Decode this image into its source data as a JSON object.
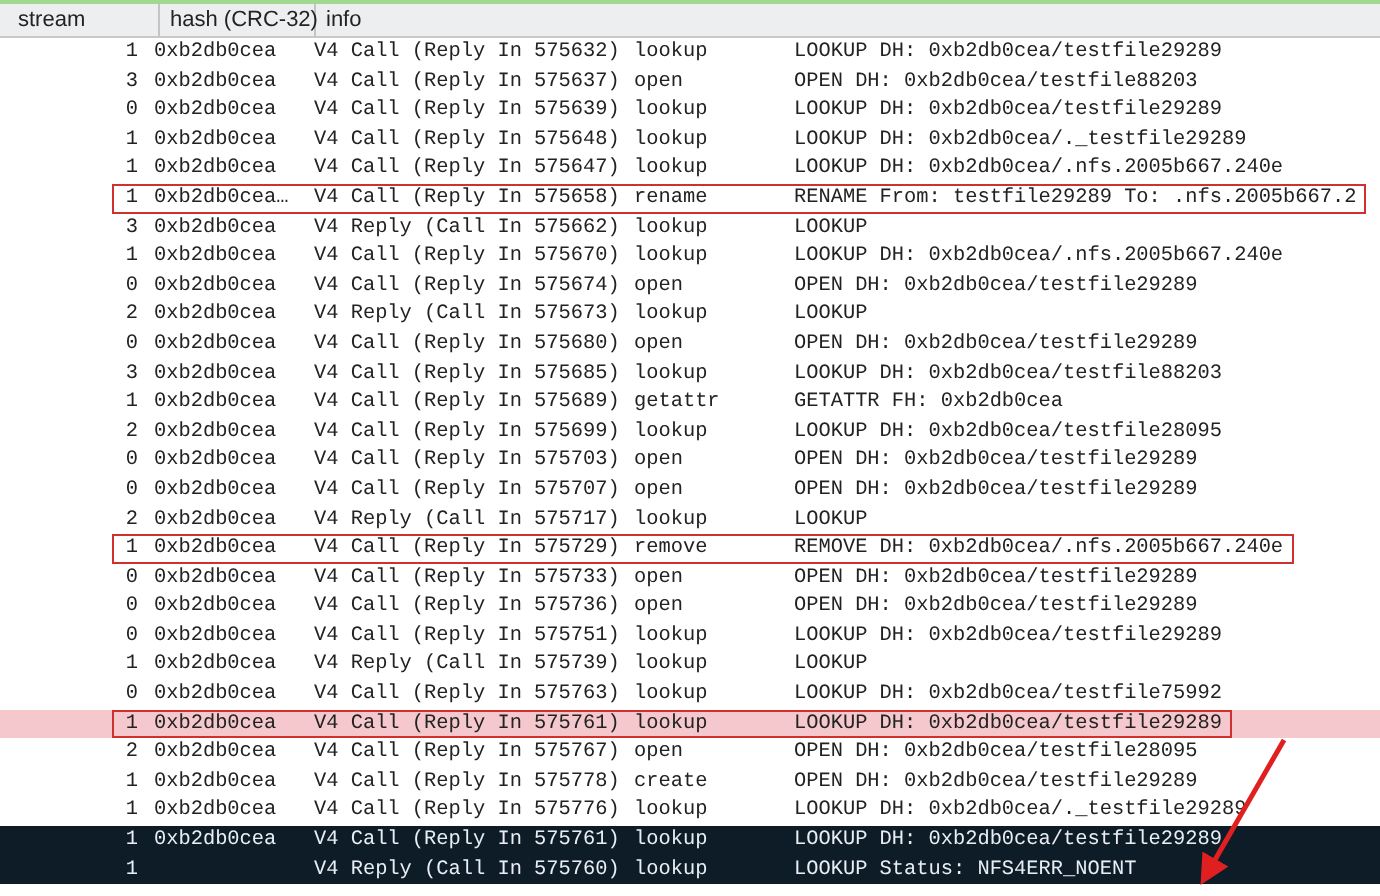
{
  "table": {
    "columns": [
      "stream",
      "hash (CRC-32)",
      "info"
    ],
    "rows": [
      {
        "stream": "1",
        "hash": "0xb2db0cea",
        "call": "V4 Call (Reply In 575632)",
        "op": "lookup",
        "summary": "LOOKUP DH: 0xb2db0cea/testfile29289",
        "boxed": false,
        "marked": false,
        "selected": false
      },
      {
        "stream": "3",
        "hash": "0xb2db0cea",
        "call": "V4 Call (Reply In 575637)",
        "op": "open",
        "summary": "OPEN DH: 0xb2db0cea/testfile88203",
        "boxed": false,
        "marked": false,
        "selected": false
      },
      {
        "stream": "0",
        "hash": "0xb2db0cea",
        "call": "V4 Call (Reply In 575639)",
        "op": "lookup",
        "summary": "LOOKUP DH: 0xb2db0cea/testfile29289",
        "boxed": false,
        "marked": false,
        "selected": false
      },
      {
        "stream": "1",
        "hash": "0xb2db0cea",
        "call": "V4 Call (Reply In 575648)",
        "op": "lookup",
        "summary": "LOOKUP DH: 0xb2db0cea/._testfile29289",
        "boxed": false,
        "marked": false,
        "selected": false
      },
      {
        "stream": "1",
        "hash": "0xb2db0cea",
        "call": "V4 Call (Reply In 575647)",
        "op": "lookup",
        "summary": "LOOKUP DH: 0xb2db0cea/.nfs.2005b667.240e",
        "boxed": false,
        "marked": false,
        "selected": false
      },
      {
        "stream": "1",
        "hash": "0xb2db0cea…",
        "call": "V4 Call (Reply In 575658)",
        "op": "rename",
        "summary": "RENAME From: testfile29289 To: .nfs.2005b667.2",
        "boxed": true,
        "marked": false,
        "selected": false
      },
      {
        "stream": "3",
        "hash": "0xb2db0cea",
        "call": "V4 Reply (Call In 575662)",
        "op": "lookup",
        "summary": "LOOKUP",
        "boxed": false,
        "marked": false,
        "selected": false
      },
      {
        "stream": "1",
        "hash": "0xb2db0cea",
        "call": "V4 Call (Reply In 575670)",
        "op": "lookup",
        "summary": "LOOKUP DH: 0xb2db0cea/.nfs.2005b667.240e",
        "boxed": false,
        "marked": false,
        "selected": false
      },
      {
        "stream": "0",
        "hash": "0xb2db0cea",
        "call": "V4 Call (Reply In 575674)",
        "op": "open",
        "summary": "OPEN DH: 0xb2db0cea/testfile29289",
        "boxed": false,
        "marked": false,
        "selected": false
      },
      {
        "stream": "2",
        "hash": "0xb2db0cea",
        "call": "V4 Reply (Call In 575673)",
        "op": "lookup",
        "summary": "LOOKUP",
        "boxed": false,
        "marked": false,
        "selected": false
      },
      {
        "stream": "0",
        "hash": "0xb2db0cea",
        "call": "V4 Call (Reply In 575680)",
        "op": "open",
        "summary": "OPEN DH: 0xb2db0cea/testfile29289",
        "boxed": false,
        "marked": false,
        "selected": false
      },
      {
        "stream": "3",
        "hash": "0xb2db0cea",
        "call": "V4 Call (Reply In 575685)",
        "op": "lookup",
        "summary": "LOOKUP DH: 0xb2db0cea/testfile88203",
        "boxed": false,
        "marked": false,
        "selected": false
      },
      {
        "stream": "1",
        "hash": "0xb2db0cea",
        "call": "V4 Call (Reply In 575689)",
        "op": "getattr",
        "summary": "GETATTR FH: 0xb2db0cea",
        "boxed": false,
        "marked": false,
        "selected": false
      },
      {
        "stream": "2",
        "hash": "0xb2db0cea",
        "call": "V4 Call (Reply In 575699)",
        "op": "lookup",
        "summary": "LOOKUP DH: 0xb2db0cea/testfile28095",
        "boxed": false,
        "marked": false,
        "selected": false
      },
      {
        "stream": "0",
        "hash": "0xb2db0cea",
        "call": "V4 Call (Reply In 575703)",
        "op": "open",
        "summary": "OPEN DH: 0xb2db0cea/testfile29289",
        "boxed": false,
        "marked": false,
        "selected": false
      },
      {
        "stream": "0",
        "hash": "0xb2db0cea",
        "call": "V4 Call (Reply In 575707)",
        "op": "open",
        "summary": "OPEN DH: 0xb2db0cea/testfile29289",
        "boxed": false,
        "marked": false,
        "selected": false
      },
      {
        "stream": "2",
        "hash": "0xb2db0cea",
        "call": "V4 Reply (Call In 575717)",
        "op": "lookup",
        "summary": "LOOKUP",
        "boxed": false,
        "marked": false,
        "selected": false
      },
      {
        "stream": "1",
        "hash": "0xb2db0cea",
        "call": "V4 Call (Reply In 575729)",
        "op": "remove",
        "summary": "REMOVE DH: 0xb2db0cea/.nfs.2005b667.240e",
        "boxed": true,
        "marked": false,
        "selected": false
      },
      {
        "stream": "0",
        "hash": "0xb2db0cea",
        "call": "V4 Call (Reply In 575733)",
        "op": "open",
        "summary": "OPEN DH: 0xb2db0cea/testfile29289",
        "boxed": false,
        "marked": false,
        "selected": false
      },
      {
        "stream": "0",
        "hash": "0xb2db0cea",
        "call": "V4 Call (Reply In 575736)",
        "op": "open",
        "summary": "OPEN DH: 0xb2db0cea/testfile29289",
        "boxed": false,
        "marked": false,
        "selected": false
      },
      {
        "stream": "0",
        "hash": "0xb2db0cea",
        "call": "V4 Call (Reply In 575751)",
        "op": "lookup",
        "summary": "LOOKUP DH: 0xb2db0cea/testfile29289",
        "boxed": false,
        "marked": false,
        "selected": false
      },
      {
        "stream": "1",
        "hash": "0xb2db0cea",
        "call": "V4 Reply (Call In 575739)",
        "op": "lookup",
        "summary": "LOOKUP",
        "boxed": false,
        "marked": false,
        "selected": false
      },
      {
        "stream": "0",
        "hash": "0xb2db0cea",
        "call": "V4 Call (Reply In 575763)",
        "op": "lookup",
        "summary": "LOOKUP DH: 0xb2db0cea/testfile75992",
        "boxed": false,
        "marked": false,
        "selected": false
      },
      {
        "stream": "1",
        "hash": "0xb2db0cea",
        "call": "V4 Call (Reply In 575761)",
        "op": "lookup",
        "summary": "LOOKUP DH: 0xb2db0cea/testfile29289",
        "boxed": true,
        "marked": true,
        "selected": false
      },
      {
        "stream": "2",
        "hash": "0xb2db0cea",
        "call": "V4 Call (Reply In 575767)",
        "op": "open",
        "summary": "OPEN DH: 0xb2db0cea/testfile28095",
        "boxed": false,
        "marked": false,
        "selected": false
      },
      {
        "stream": "1",
        "hash": "0xb2db0cea",
        "call": "V4 Call (Reply In 575778)",
        "op": "create",
        "summary": "OPEN DH: 0xb2db0cea/testfile29289",
        "boxed": false,
        "marked": false,
        "selected": false
      },
      {
        "stream": "1",
        "hash": "0xb2db0cea",
        "call": "V4 Call (Reply In 575776)",
        "op": "lookup",
        "summary": "LOOKUP DH: 0xb2db0cea/._testfile29289",
        "boxed": false,
        "marked": false,
        "selected": false
      },
      {
        "stream": "1",
        "hash": "0xb2db0cea",
        "call": "V4 Call (Reply In 575761)",
        "op": "lookup",
        "summary": "LOOKUP DH: 0xb2db0cea/testfile29289",
        "boxed": false,
        "marked": false,
        "selected": true
      },
      {
        "stream": "1",
        "hash": "",
        "call": "V4 Reply (Call In 575760)",
        "op": "lookup",
        "summary": "LOOKUP Status: NFS4ERR_NOENT",
        "boxed": false,
        "marked": false,
        "selected": true
      }
    ]
  }
}
